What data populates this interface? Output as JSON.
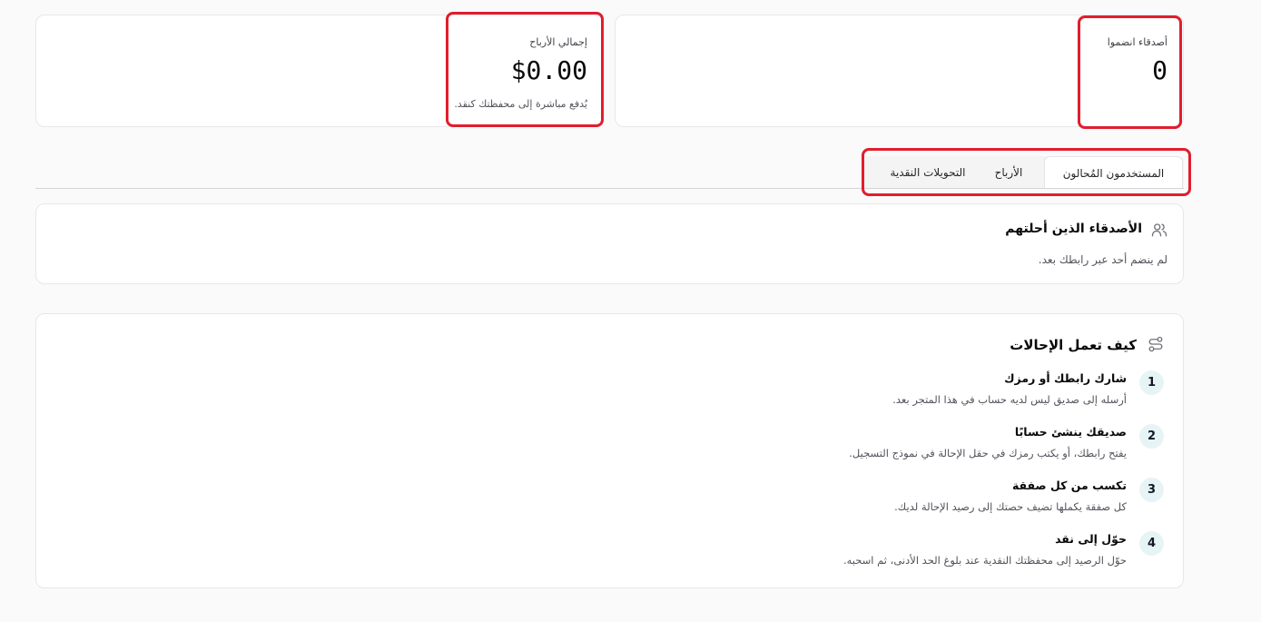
{
  "stats": {
    "friends_joined": {
      "label": "أصدقاء انضموا",
      "value": "0"
    },
    "total_earnings": {
      "label": "إجمالي الأرباح",
      "value": "$0.00",
      "note": "يُدفع مباشرة إلى محفظتك كنقد."
    }
  },
  "tabs": [
    {
      "label": "المستخدمون المُحالون",
      "active": true
    },
    {
      "label": "الأرباح",
      "active": false
    },
    {
      "label": "التحويلات النقدية",
      "active": false
    }
  ],
  "referred_friends": {
    "title": "الأصدقاء الذين أحلتهم",
    "empty_text": "لم ينضم أحد عبر رابطك بعد."
  },
  "how_it_works": {
    "title": "كيف تعمل الإحالات",
    "steps": [
      {
        "num": "1",
        "title": "شارك رابطك أو رمزك",
        "text": "أرسله إلى صديق ليس لديه حساب في هذا المتجر بعد."
      },
      {
        "num": "2",
        "title": "صديقك ينشئ حسابًا",
        "text": "يفتح رابطك، أو يكتب رمزك في حقل الإحالة في نموذج التسجيل."
      },
      {
        "num": "3",
        "title": "تكسب من كل صفقة",
        "text": "كل صفقة يكملها تضيف حصتك إلى رصيد الإحالة لديك."
      },
      {
        "num": "4",
        "title": "حوّل إلى نقد",
        "text": "حوّل الرصيد إلى محفظتك النقدية عند بلوغ الحد الأدنى، ثم اسحبه."
      }
    ]
  },
  "colors": {
    "highlight": "#e11d2e",
    "step_badge": "#e6f4f6"
  },
  "icons": {
    "friends": "users-icon",
    "how_it_works": "route-icon"
  }
}
